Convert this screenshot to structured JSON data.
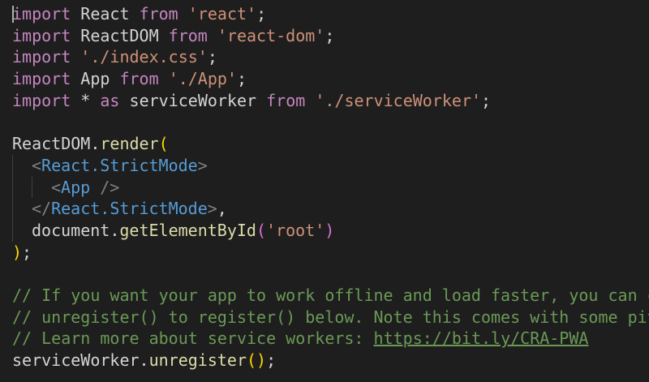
{
  "editor": {
    "lines": [
      {
        "kw1": "import",
        "id": "React",
        "kw2": "from",
        "str": "'react'",
        "semi": ";"
      },
      {
        "kw1": "import",
        "id": "ReactDOM",
        "kw2": "from",
        "str": "'react-dom'",
        "semi": ";"
      },
      {
        "kw1": "import",
        "str": "'./index.css'",
        "semi": ";"
      },
      {
        "kw1": "import",
        "id": "App",
        "kw2": "from",
        "str": "'./App'",
        "semi": ";"
      },
      {
        "kw1": "import",
        "star": "*",
        "as": "as",
        "id": "serviceWorker",
        "kw2": "from",
        "str": "'./serviceWorker'",
        "semi": ";"
      }
    ],
    "render": {
      "obj": "ReactDOM",
      "method": "render",
      "open_paren": "(",
      "strict_open_lt": "<",
      "strict_tag": "React.StrictMode",
      "strict_open_gt": ">",
      "app_lt": "<",
      "app_tag": "App",
      "app_close": " />",
      "strict_close_lt": "</",
      "strict_close_gt": ">",
      "comma": ",",
      "doc": "document",
      "get_by_id": "getElementById",
      "inner_open": "(",
      "root": "'root'",
      "inner_close": ")",
      "close_paren": ")",
      "semi": ";"
    },
    "comments": [
      "// If you want your app to work offline and load faster, you can change",
      "// unregister() to register() below. Note this comes with some pitfalls.",
      "// Learn more about service workers: "
    ],
    "comment_url": "https://bit.ly/CRA-PWA",
    "last": {
      "obj": "serviceWorker",
      "method": "unregister",
      "parens": "()",
      "semi": ";"
    }
  }
}
